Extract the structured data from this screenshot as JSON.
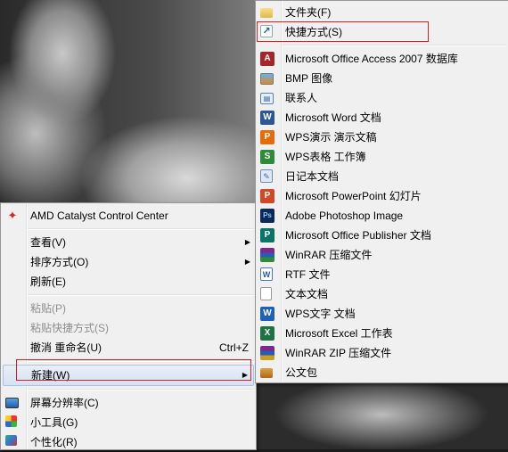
{
  "context_menu": {
    "items": [
      {
        "label": "AMD Catalyst Control Center",
        "icon": "amd-icon"
      },
      {
        "label": "查看(V)",
        "submenu": true
      },
      {
        "label": "排序方式(O)",
        "submenu": true
      },
      {
        "label": "刷新(E)"
      },
      {
        "label": "粘贴(P)",
        "disabled": true
      },
      {
        "label": "粘贴快捷方式(S)",
        "disabled": true
      },
      {
        "label": "撤消 重命名(U)",
        "shortcut": "Ctrl+Z"
      },
      {
        "label": "新建(W)",
        "submenu": true
      },
      {
        "label": "屏幕分辨率(C)",
        "icon": "display-icon"
      },
      {
        "label": "小工具(G)",
        "icon": "gadgets-icon"
      },
      {
        "label": "个性化(R)",
        "icon": "personalize-icon"
      }
    ]
  },
  "new_submenu": {
    "items": [
      {
        "label": "文件夹(F)",
        "icon": "folder-icon"
      },
      {
        "label": "快捷方式(S)",
        "icon": "shortcut-icon"
      },
      {
        "label": "Microsoft Office Access 2007 数据库",
        "icon": "access-icon"
      },
      {
        "label": "BMP 图像",
        "icon": "bmp-icon"
      },
      {
        "label": "联系人",
        "icon": "contact-icon"
      },
      {
        "label": "Microsoft Word 文档",
        "icon": "word-icon"
      },
      {
        "label": "WPS演示 演示文稿",
        "icon": "wps-presentation-icon"
      },
      {
        "label": "WPS表格 工作簿",
        "icon": "wps-spreadsheet-icon"
      },
      {
        "label": "日记本文档",
        "icon": "journal-icon"
      },
      {
        "label": "Microsoft PowerPoint 幻灯片",
        "icon": "powerpoint-icon"
      },
      {
        "label": "Adobe Photoshop Image",
        "icon": "photoshop-icon"
      },
      {
        "label": "Microsoft Office Publisher 文档",
        "icon": "publisher-icon"
      },
      {
        "label": "WinRAR 压缩文件",
        "icon": "winrar-icon"
      },
      {
        "label": "RTF 文件",
        "icon": "rtf-icon"
      },
      {
        "label": "文本文档",
        "icon": "text-document-icon"
      },
      {
        "label": "WPS文字 文档",
        "icon": "wps-writer-icon"
      },
      {
        "label": "Microsoft Excel 工作表",
        "icon": "excel-icon"
      },
      {
        "label": "WinRAR ZIP 压缩文件",
        "icon": "winrar-zip-icon"
      },
      {
        "label": "公文包",
        "icon": "briefcase-icon"
      }
    ]
  },
  "colors": {
    "highlight_border": "#d02020",
    "menu_bg": "#f0f0f0"
  }
}
